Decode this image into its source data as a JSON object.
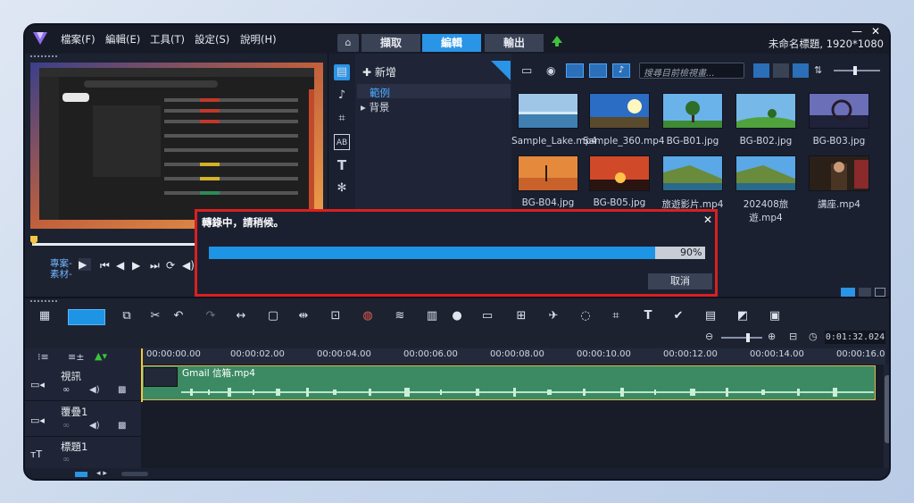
{
  "menu": [
    "檔案(F)",
    "編輯(E)",
    "工具(T)",
    "設定(S)",
    "說明(H)"
  ],
  "tabs": [
    "擷取",
    "編輯",
    "輸出"
  ],
  "project_title": "未命名標題, 1920*1080",
  "preview": {
    "project_label": "專案-",
    "clip_label": "素材-"
  },
  "library": {
    "add_label": "新增",
    "tree": [
      "範例",
      "背景"
    ],
    "search_placeholder": "搜尋目前檢視畫..."
  },
  "media": [
    {
      "label": "Sample_Lake.mp4",
      "icon": "video-icon"
    },
    {
      "label": "Sample_360.mp4",
      "icon": "video-icon"
    },
    {
      "label": "BG-B01.jpg",
      "icon": "image-icon"
    },
    {
      "label": "BG-B02.jpg",
      "icon": "image-icon"
    },
    {
      "label": "BG-B03.jpg",
      "icon": "image-icon"
    },
    {
      "label": "BG-B04.jpg",
      "icon": "image-icon"
    },
    {
      "label": "BG-B05.jpg",
      "icon": "image-icon"
    },
    {
      "label": "旅遊影片.mp4",
      "icon": "video-icon"
    },
    {
      "label": "202408旅遊.mp4",
      "icon": "video-icon"
    },
    {
      "label": "講座.mp4",
      "icon": "video-icon"
    }
  ],
  "dialog": {
    "title": "轉錄中，請稍候。",
    "progress": 0.9,
    "percent_text": "90%",
    "cancel_label": "取消"
  },
  "timeline": {
    "timecode": "0:01:32.024",
    "ruler": [
      "00:00:00.00",
      "00:00:02.00",
      "00:00:04.00",
      "00:00:06.00",
      "00:00:08.00",
      "00:00:10.00",
      "00:00:12.00",
      "00:00:14.00",
      "00:00:16.0"
    ],
    "tracks": [
      "視訊",
      "覆疊1",
      "標題1"
    ],
    "clip_name": "Gmail 信箱.mp4"
  },
  "colors": {
    "accent": "#1d94e4",
    "alert": "#d92020",
    "clip": "#3c8a63"
  }
}
